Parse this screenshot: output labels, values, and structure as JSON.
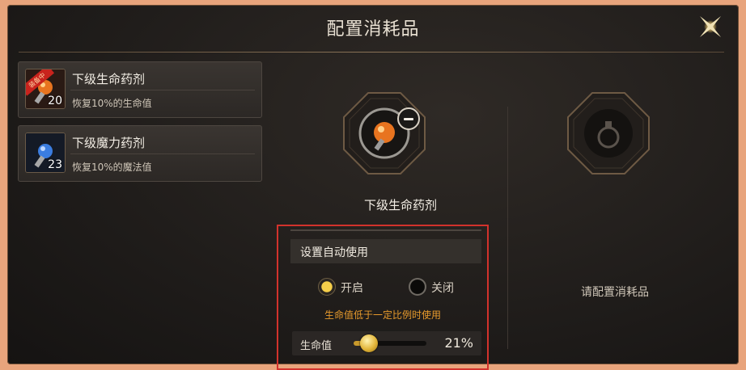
{
  "window": {
    "title": "配置消耗品"
  },
  "items": [
    {
      "name": "下级生命药剂",
      "description": "恢复10%的生命值",
      "count": "20",
      "badge": "装备中",
      "icon": "health-potion-icon"
    },
    {
      "name": "下级魔力药剂",
      "description": "恢复10%的魔法值",
      "count": "23",
      "icon": "mana-potion-icon"
    }
  ],
  "slots": {
    "left": {
      "label": "下级生命药剂",
      "icon": "health-potion-icon"
    },
    "right": {
      "label": "请配置消耗品",
      "icon": "empty-flask-icon"
    }
  },
  "auto_use": {
    "header": "设置自动使用",
    "on_label": "开启",
    "off_label": "关闭",
    "selected": "on",
    "hint": "生命值低于一定比例时使用",
    "slider_label": "生命值",
    "slider_value": 0.21,
    "slider_text": "21%"
  },
  "colors": {
    "accent": "#e79a2c",
    "highlight_border": "#d2322c",
    "health": "#e8741f",
    "mana": "#3b7de0"
  }
}
